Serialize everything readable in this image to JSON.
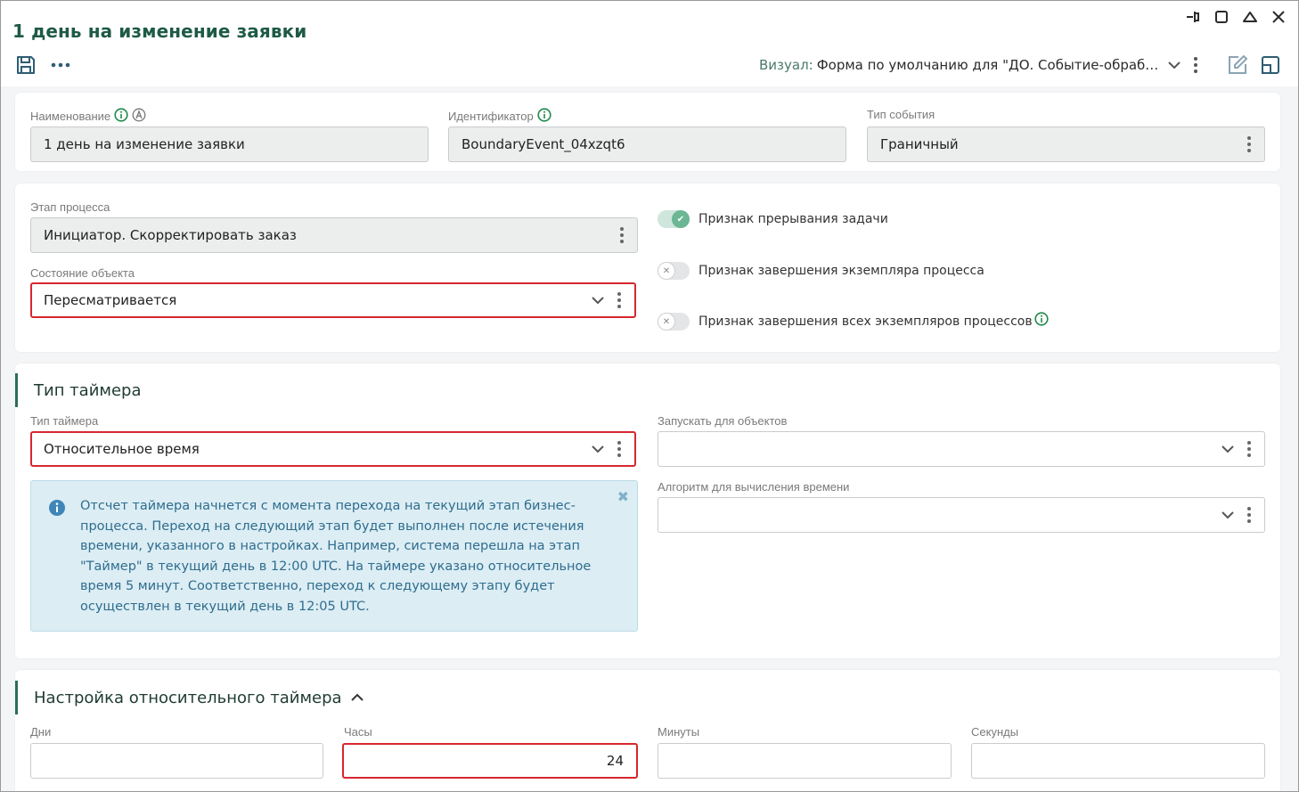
{
  "header": {
    "title": "1 день на изменение заявки",
    "visual_label": "Визуал:",
    "visual_value": "Форма по умолчанию для \"ДО. Событие-обраб…"
  },
  "general": {
    "name_label": "Наименование",
    "name_value": "1 день на изменение заявки",
    "id_label": "Идентификатор",
    "id_value": "BoundaryEvent_04xzqt6",
    "event_type_label": "Тип события",
    "event_type_value": "Граничный"
  },
  "process": {
    "stage_label": "Этап процесса",
    "stage_value": "Инициатор. Скорректировать заказ",
    "state_label": "Состояние объекта",
    "state_value": "Пересматривается",
    "toggles": [
      {
        "label": "Признак прерывания задачи",
        "on": true
      },
      {
        "label": "Признак завершения экземпляра процесса",
        "on": false
      },
      {
        "label": "Признак завершения всех экземпляров процессов",
        "on": false
      }
    ]
  },
  "timer": {
    "section_title": "Тип таймера",
    "type_label": "Тип таймера",
    "type_value": "Относительное время",
    "run_for_label": "Запускать для объектов",
    "run_for_value": "",
    "algorithm_label": "Алгоритм для вычисления времени",
    "algorithm_value": "",
    "info_text": "Отсчет таймера начнется с момента перехода на текущий этап бизнес-процесса. Переход на следующий этап будет выполнен после истечения времени, указанного в настройках. Например, система перешла на этап \"Таймер\" в текущий день в 12:00 UTC. На таймере указано относительное время 5 минут. Соответственно, переход к следующему этапу будет осуществлен в текущий день в 12:05 UTC."
  },
  "relative": {
    "section_title": "Настройка относительного таймера",
    "days_label": "Дни",
    "days_value": "",
    "hours_label": "Часы",
    "hours_value": "24",
    "minutes_label": "Минуты",
    "minutes_value": "",
    "seconds_label": "Секунды",
    "seconds_value": ""
  },
  "colors": {
    "accent": "#1e5a46",
    "highlight": "#d8262f",
    "info_bg": "#dcedf4",
    "info_text": "#2f6d8e",
    "toggle_on": "#6cb694"
  }
}
